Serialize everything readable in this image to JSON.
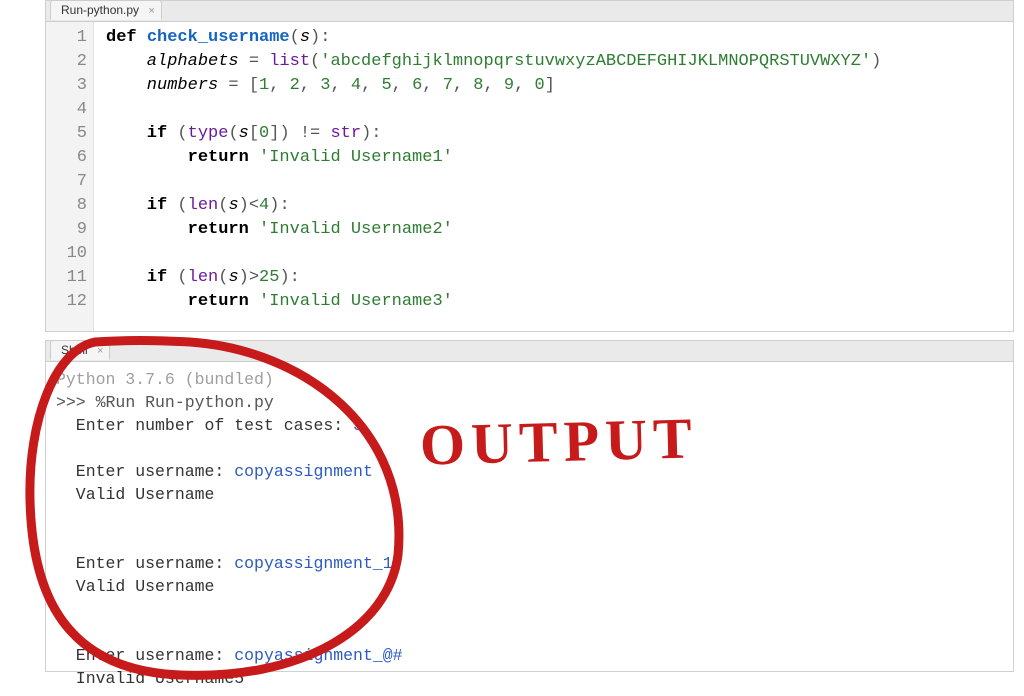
{
  "editor": {
    "tab_label": "Run-python.py",
    "line_numbers": [
      "1",
      "2",
      "3",
      "4",
      "5",
      "6",
      "7",
      "8",
      "9",
      "10",
      "11",
      "12"
    ],
    "code_tokens": [
      [
        {
          "c": "tok-kw",
          "t": "def "
        },
        {
          "c": "tok-def",
          "t": "check_username"
        },
        {
          "c": "tok-pn",
          "t": "("
        },
        {
          "c": "tok-id",
          "t": "s"
        },
        {
          "c": "tok-pn",
          "t": "):"
        }
      ],
      [
        {
          "c": "tok-id",
          "t": "    alphabets"
        },
        {
          "c": "tok-op",
          "t": " = "
        },
        {
          "c": "tok-bi",
          "t": "list"
        },
        {
          "c": "tok-pn",
          "t": "("
        },
        {
          "c": "tok-str",
          "t": "'abcdefghijklmnopqrstuvwxyzABCDEFGHIJKLMNOPQRSTUVWXYZ'"
        },
        {
          "c": "tok-pn",
          "t": ")"
        }
      ],
      [
        {
          "c": "tok-id",
          "t": "    numbers"
        },
        {
          "c": "tok-op",
          "t": " = "
        },
        {
          "c": "tok-pn",
          "t": "["
        },
        {
          "c": "tok-num",
          "t": "1"
        },
        {
          "c": "tok-pn",
          "t": ", "
        },
        {
          "c": "tok-num",
          "t": "2"
        },
        {
          "c": "tok-pn",
          "t": ", "
        },
        {
          "c": "tok-num",
          "t": "3"
        },
        {
          "c": "tok-pn",
          "t": ", "
        },
        {
          "c": "tok-num",
          "t": "4"
        },
        {
          "c": "tok-pn",
          "t": ", "
        },
        {
          "c": "tok-num",
          "t": "5"
        },
        {
          "c": "tok-pn",
          "t": ", "
        },
        {
          "c": "tok-num",
          "t": "6"
        },
        {
          "c": "tok-pn",
          "t": ", "
        },
        {
          "c": "tok-num",
          "t": "7"
        },
        {
          "c": "tok-pn",
          "t": ", "
        },
        {
          "c": "tok-num",
          "t": "8"
        },
        {
          "c": "tok-pn",
          "t": ", "
        },
        {
          "c": "tok-num",
          "t": "9"
        },
        {
          "c": "tok-pn",
          "t": ", "
        },
        {
          "c": "tok-num",
          "t": "0"
        },
        {
          "c": "tok-pn",
          "t": "]"
        }
      ],
      [],
      [
        {
          "c": "tok-kw",
          "t": "    if "
        },
        {
          "c": "tok-pn",
          "t": "("
        },
        {
          "c": "tok-bi",
          "t": "type"
        },
        {
          "c": "tok-pn",
          "t": "("
        },
        {
          "c": "tok-id",
          "t": "s"
        },
        {
          "c": "tok-pn",
          "t": "["
        },
        {
          "c": "tok-num",
          "t": "0"
        },
        {
          "c": "tok-pn",
          "t": "]) "
        },
        {
          "c": "tok-op",
          "t": "!="
        },
        {
          "c": "tok-pn",
          "t": " "
        },
        {
          "c": "tok-bi",
          "t": "str"
        },
        {
          "c": "tok-pn",
          "t": "):"
        }
      ],
      [
        {
          "c": "tok-kw",
          "t": "        return "
        },
        {
          "c": "tok-str",
          "t": "'Invalid Username1'"
        }
      ],
      [],
      [
        {
          "c": "tok-kw",
          "t": "    if "
        },
        {
          "c": "tok-pn",
          "t": "("
        },
        {
          "c": "tok-bi",
          "t": "len"
        },
        {
          "c": "tok-pn",
          "t": "("
        },
        {
          "c": "tok-id",
          "t": "s"
        },
        {
          "c": "tok-pn",
          "t": ")"
        },
        {
          "c": "tok-op",
          "t": "<"
        },
        {
          "c": "tok-num",
          "t": "4"
        },
        {
          "c": "tok-pn",
          "t": "):"
        }
      ],
      [
        {
          "c": "tok-kw",
          "t": "        return "
        },
        {
          "c": "tok-str",
          "t": "'Invalid Username2'"
        }
      ],
      [],
      [
        {
          "c": "tok-kw",
          "t": "    if "
        },
        {
          "c": "tok-pn",
          "t": "("
        },
        {
          "c": "tok-bi",
          "t": "len"
        },
        {
          "c": "tok-pn",
          "t": "("
        },
        {
          "c": "tok-id",
          "t": "s"
        },
        {
          "c": "tok-pn",
          "t": ")"
        },
        {
          "c": "tok-op",
          "t": ">"
        },
        {
          "c": "tok-num",
          "t": "25"
        },
        {
          "c": "tok-pn",
          "t": "):"
        }
      ],
      [
        {
          "c": "tok-kw",
          "t": "        return "
        },
        {
          "c": "tok-str",
          "t": "'Invalid Username3'"
        }
      ]
    ]
  },
  "shell": {
    "tab_label": "Shell",
    "banner": "Python 3.7.6 (bundled)",
    "prompt": ">>> ",
    "run_cmd": "%Run Run-python.py",
    "lines": [
      {
        "text": "  Enter number of test cases: ",
        "input": "3"
      },
      {
        "text": ""
      },
      {
        "text": "  Enter username: ",
        "input": "copyassignment"
      },
      {
        "text": "  Valid Username"
      },
      {
        "text": ""
      },
      {
        "text": ""
      },
      {
        "text": "  Enter username: ",
        "input": "copyassignment_1"
      },
      {
        "text": "  Valid Username"
      },
      {
        "text": ""
      },
      {
        "text": ""
      },
      {
        "text": "  Enter username: ",
        "input": "copyassignment_@#"
      },
      {
        "text": "  Invalid Username5"
      }
    ]
  },
  "annotation": {
    "label": "OUTPUT"
  }
}
